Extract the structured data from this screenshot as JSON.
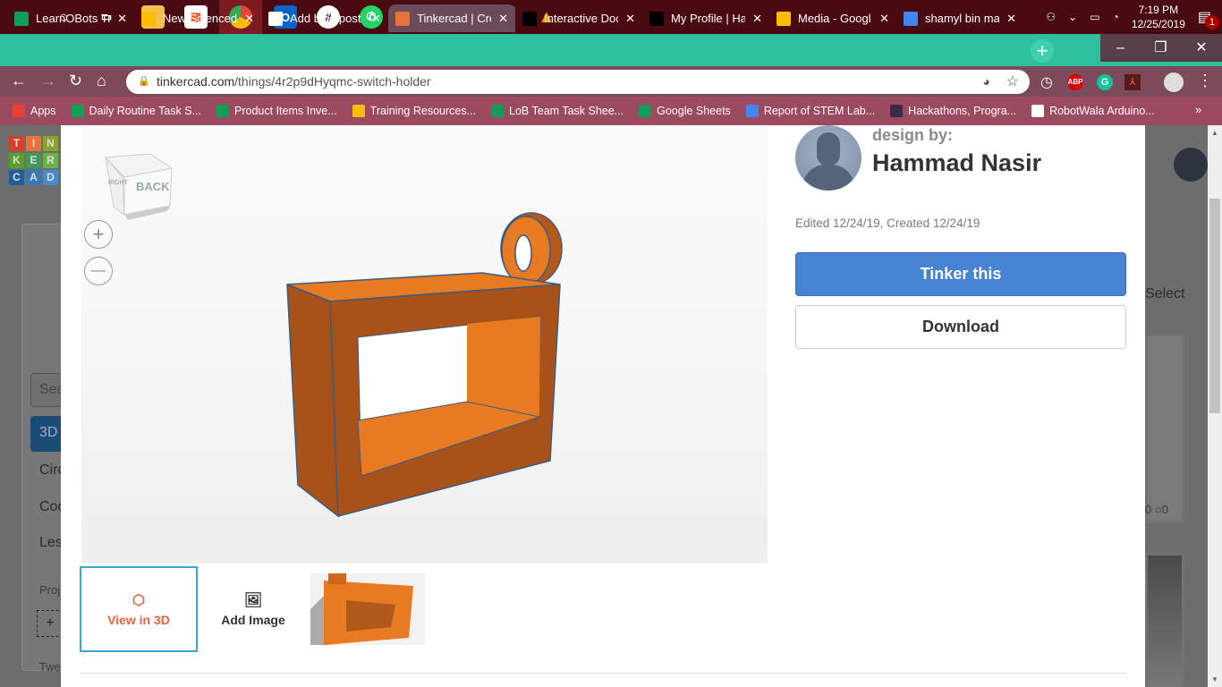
{
  "taskbar": {
    "apps": [
      "start",
      "cortana",
      "task-view",
      "file-explorer",
      "store",
      "chrome",
      "outlook",
      "slack",
      "whatsapp",
      "sticky-notes",
      "malwarebytes",
      "word",
      "vlc"
    ],
    "time": "7:19 PM",
    "date": "12/25/2019",
    "notifications": "1"
  },
  "browser": {
    "tabs": [
      {
        "label": "LearnOBots Tra",
        "color": "#0f9d58"
      },
      {
        "label": "New Scienceda",
        "color": "#fbbc04"
      },
      {
        "label": "Add blog post",
        "color": "#ffffff"
      },
      {
        "label": "Tinkercad | Cre",
        "color": "#e8733a",
        "active": true
      },
      {
        "label": "Interactive Doc",
        "color": "#000000"
      },
      {
        "label": "My Profile | Ha",
        "color": "#000000"
      },
      {
        "label": "Media - Googl",
        "color": "#fbbc04"
      },
      {
        "label": "shamyl bin ma",
        "color": "#4285f4"
      }
    ],
    "url_domain": "tinkercad.com",
    "url_path": "/things/4r2p9dHyqmc-switch-holder",
    "bookmarks": [
      {
        "label": "Apps",
        "color": "#e94235"
      },
      {
        "label": "Daily Routine Task S...",
        "color": "#0f9d58"
      },
      {
        "label": "Product Items Inve...",
        "color": "#0f9d58"
      },
      {
        "label": "Training Resources...",
        "color": "#fbbc04"
      },
      {
        "label": "LoB Team Task Shee...",
        "color": "#0f9d58"
      },
      {
        "label": "Google Sheets",
        "color": "#0f9d58"
      },
      {
        "label": "Report of STEM Lab...",
        "color": "#4285f4"
      },
      {
        "label": "Hackathons, Progra...",
        "color": "#3b2a4a"
      },
      {
        "label": "RobotWala Arduino...",
        "color": "#ffffff"
      }
    ],
    "extensions": [
      "speed",
      "ABP",
      "G",
      "pdf"
    ]
  },
  "background": {
    "logo": [
      "T",
      "I",
      "N",
      "K",
      "E",
      "R",
      "C",
      "A",
      "D"
    ],
    "search": "Sea",
    "nav": [
      "3D",
      "Circ",
      "Cod",
      "Les"
    ],
    "projects": "Proj",
    "add": "+",
    "footer": "Twe",
    "select": "Select",
    "counts": "0 ○0"
  },
  "viewer": {
    "cube_back": "BACK",
    "cube_right": "RIGHT",
    "zoom_in": "+",
    "zoom_out": "—",
    "object_color": "#e87a22"
  },
  "thumbs": {
    "view3d": "View in 3D",
    "add_image": "Add Image"
  },
  "designer": {
    "label": "design by:",
    "name": "Hammad Nasir",
    "dates": "Edited 12/24/19, Created 12/24/19"
  },
  "actions": {
    "tinker": "Tinker this",
    "download": "Download"
  }
}
